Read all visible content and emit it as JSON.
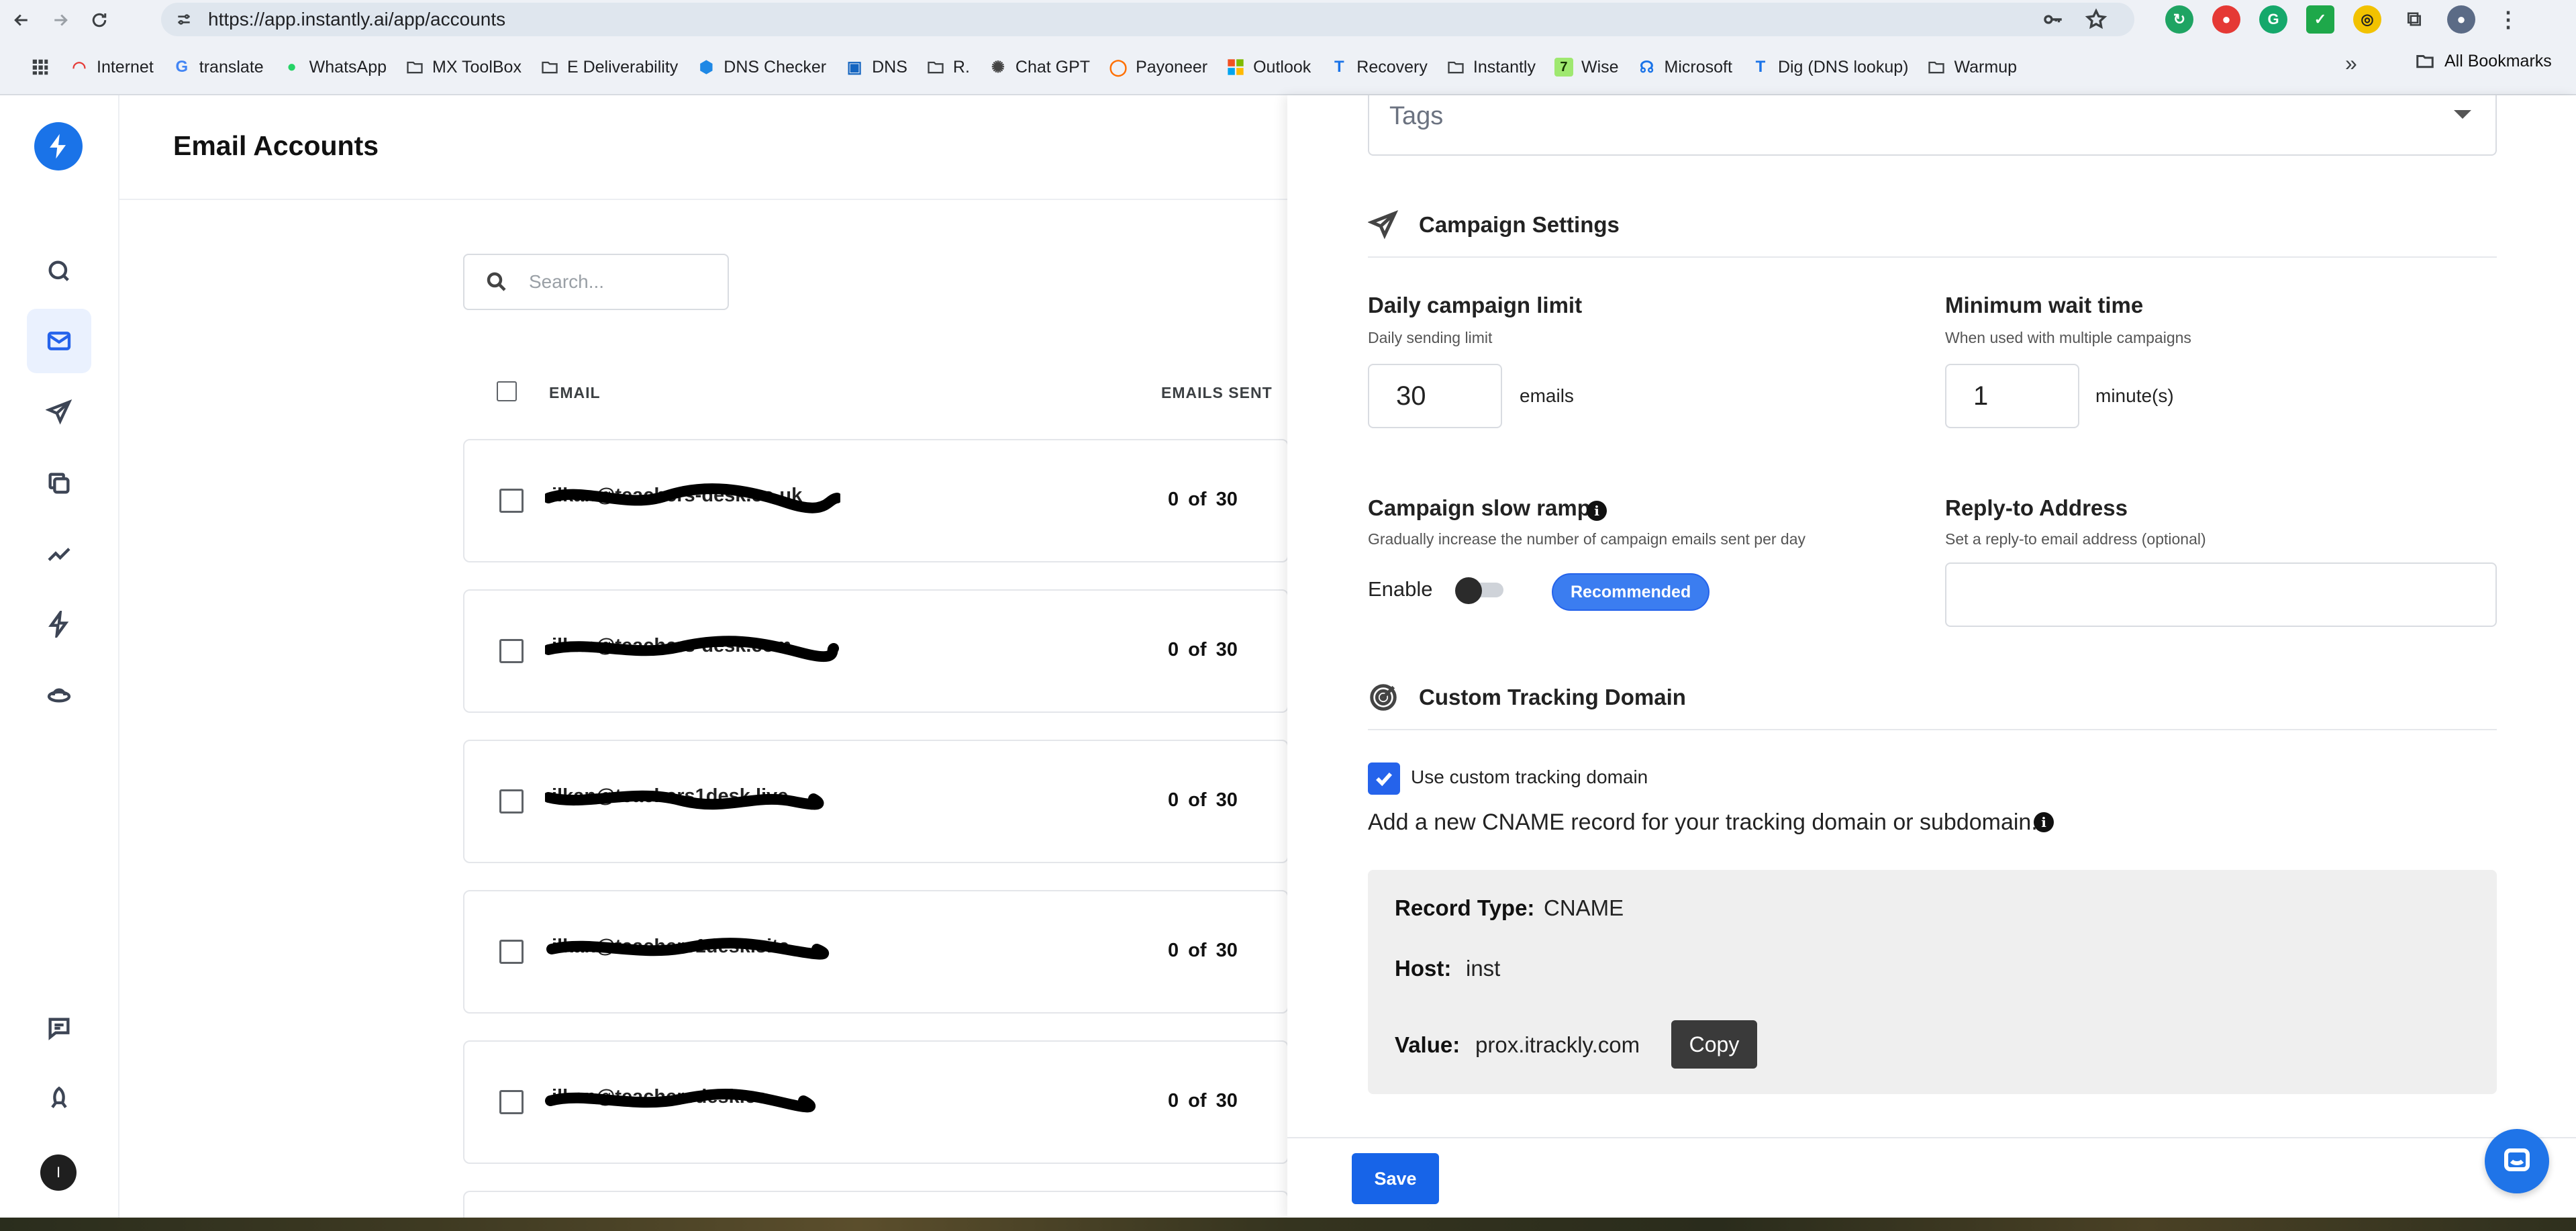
{
  "browser": {
    "url": "https://app.instantly.ai/app/accounts",
    "bookmarks": [
      "Internet",
      "translate",
      "WhatsApp",
      "MX ToolBox",
      "E Deliverability",
      "DNS Checker",
      "DNS",
      "R.",
      "Chat GPT",
      "Payoneer",
      "Outlook",
      "Recovery",
      "Instantly",
      "Wise",
      "Microsoft",
      "Dig (DNS lookup)",
      "Warmup"
    ],
    "more": "»",
    "all_bookmarks": "All Bookmarks"
  },
  "header": {
    "title": "Email Accounts"
  },
  "search": {
    "placeholder": "Search..."
  },
  "table": {
    "columns": {
      "email": "EMAIL",
      "emails_sent": "EMAILS SENT"
    },
    "rows": [
      {
        "email": "ilkan@teachers-desk.co.uk",
        "sent": "0 of 30"
      },
      {
        "email": "ilkan@teachers-desk.com",
        "sent": "0 of 30"
      },
      {
        "email": "ilkan@teachers1desk.live",
        "sent": "0 of 30"
      },
      {
        "email": "ilkan@teachers1desk.site",
        "sent": "0 of 30"
      },
      {
        "email": "ilkan@teachersdesk.co",
        "sent": "0 of 30"
      }
    ]
  },
  "sidebar": {
    "avatar_initial": "I"
  },
  "panel": {
    "tags_placeholder": "Tags",
    "campaign_settings": {
      "title": "Campaign Settings",
      "daily_limit": {
        "title": "Daily campaign limit",
        "subtitle": "Daily sending limit",
        "value": "30",
        "unit": "emails"
      },
      "min_wait": {
        "title": "Minimum wait time",
        "subtitle": "When used with multiple campaigns",
        "value": "1",
        "unit": "minute(s)"
      },
      "slow_ramp": {
        "title": "Campaign slow ramp",
        "subtitle": "Gradually increase the number of campaign emails sent per day",
        "enable_label": "Enable",
        "badge": "Recommended"
      },
      "reply_to": {
        "title": "Reply-to Address",
        "subtitle": "Set a reply-to email address (optional)"
      }
    },
    "tracking": {
      "title": "Custom Tracking Domain",
      "checkbox_label": "Use custom tracking domain",
      "instructions": "Add a new CNAME record for your tracking domain or subdomain.",
      "record_type_label": "Record Type:",
      "record_type_value": "CNAME",
      "host_label": "Host:",
      "host_value": "inst",
      "value_label": "Value:",
      "value_value": "prox.itrackly.com",
      "copy_label": "Copy"
    },
    "save_label": "Save"
  },
  "colors": {
    "accent": "#2563eb",
    "logo": "#1a73e8",
    "chat": "#1f74e8"
  }
}
